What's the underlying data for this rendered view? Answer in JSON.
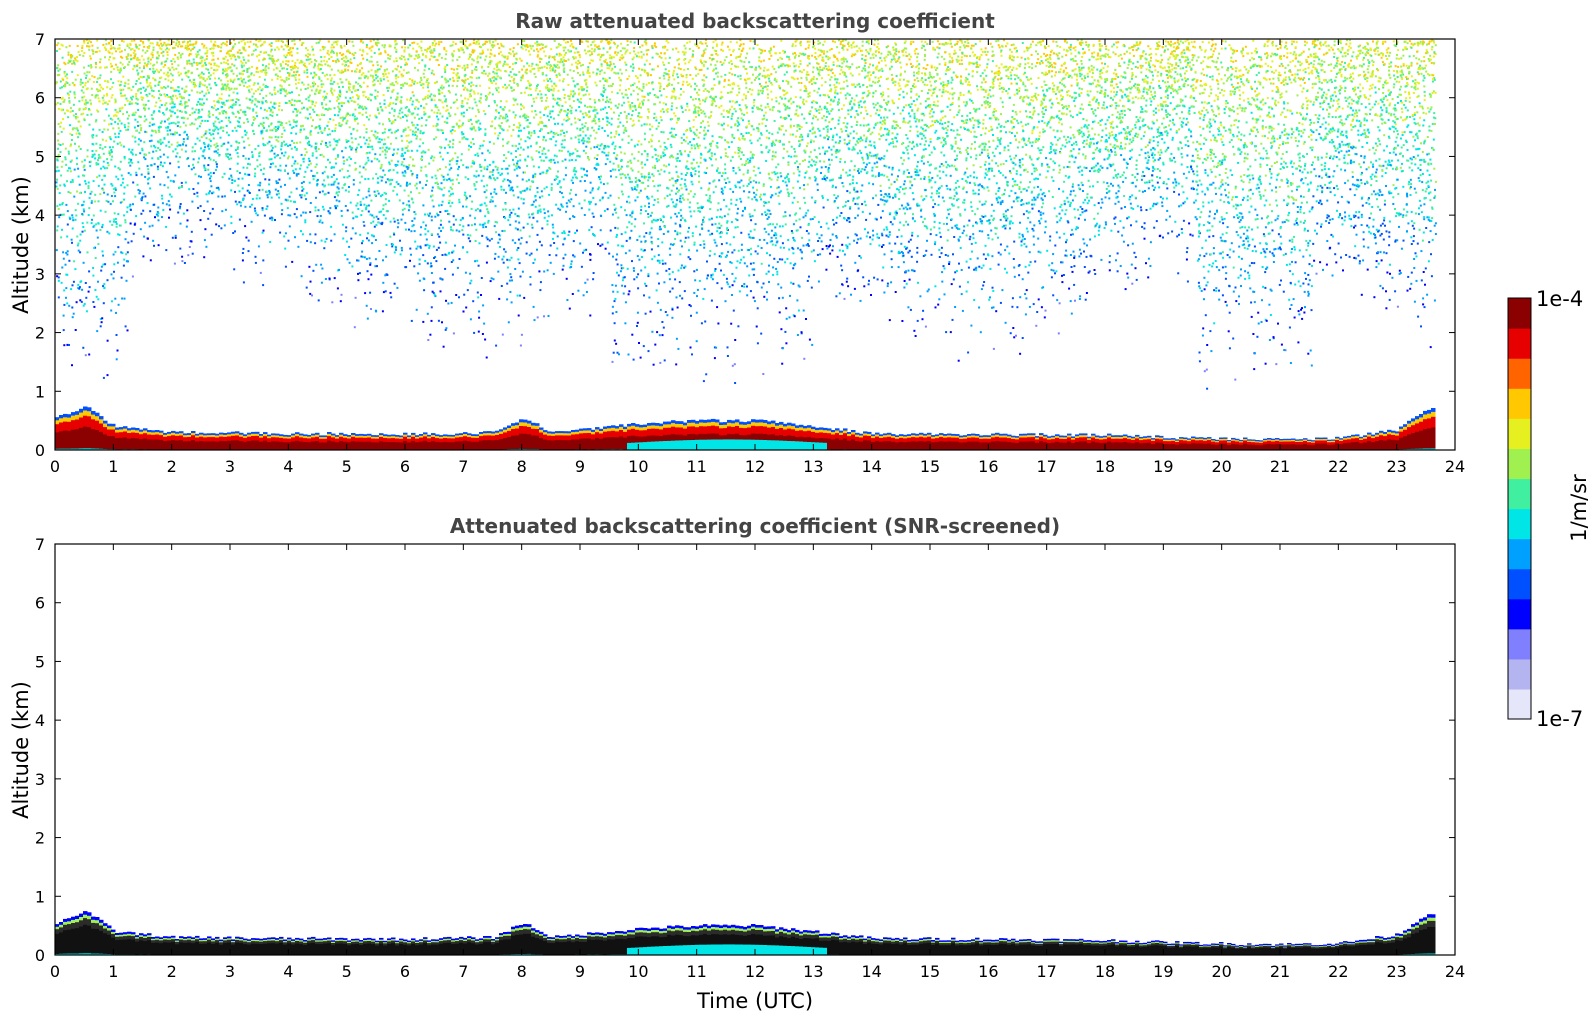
{
  "chart_data": [
    {
      "type": "heatmap",
      "title": "Raw attenuated backscattering coefficient",
      "xlabel": "",
      "ylabel": "Altitude (km)",
      "xlim": [
        0,
        24
      ],
      "ylim": [
        0,
        7
      ],
      "xticks": [
        "0",
        "1",
        "2",
        "3",
        "4",
        "5",
        "6",
        "7",
        "8",
        "9",
        "10",
        "11",
        "12",
        "13",
        "14",
        "15",
        "16",
        "17",
        "18",
        "19",
        "20",
        "21",
        "22",
        "23",
        "24"
      ],
      "yticks": [
        "0",
        "1",
        "2",
        "3",
        "4",
        "5",
        "6",
        "7"
      ],
      "data_end_hour": 23.7,
      "boundary_layer": {
        "time_h": [
          0.0,
          0.5,
          1.0,
          2.0,
          4.0,
          6.0,
          7.5,
          8.0,
          8.5,
          9.0,
          10.0,
          11.0,
          12.0,
          13.0,
          14.0,
          16.0,
          18.0,
          19.5,
          21.0,
          22.0,
          23.0,
          23.5,
          23.7
        ],
        "top_km": [
          0.55,
          0.75,
          0.4,
          0.3,
          0.28,
          0.27,
          0.3,
          0.55,
          0.3,
          0.35,
          0.45,
          0.5,
          0.5,
          0.4,
          0.28,
          0.27,
          0.25,
          0.2,
          0.18,
          0.2,
          0.35,
          0.7,
          0.75
        ]
      },
      "noise_floor_km": [
        {
          "time_h": [
            0,
            1.2
          ],
          "bottom_km": 1.0
        },
        {
          "time_h": [
            9.5,
            13.0
          ],
          "bottom_km": 1.0
        },
        {
          "time_h": [
            19.5,
            21.5
          ],
          "bottom_km": 0.9
        }
      ]
    },
    {
      "type": "heatmap",
      "title": "Attenuated backscattering coefficient (SNR-screened)",
      "xlabel": "Time (UTC)",
      "ylabel": "Altitude (km)",
      "xlim": [
        0,
        24
      ],
      "ylim": [
        0,
        7
      ],
      "xticks": [
        "0",
        "1",
        "2",
        "3",
        "4",
        "5",
        "6",
        "7",
        "8",
        "9",
        "10",
        "11",
        "12",
        "13",
        "14",
        "15",
        "16",
        "17",
        "18",
        "19",
        "20",
        "21",
        "22",
        "23",
        "24"
      ],
      "yticks": [
        "0",
        "1",
        "2",
        "3",
        "4",
        "5",
        "6",
        "7"
      ],
      "data_end_hour": 23.7
    }
  ],
  "colorbar": {
    "label": "1/m/sr",
    "min_label": "1e-7",
    "max_label": "1e-4",
    "scale": "log",
    "colors": [
      "#e6e6fa",
      "#b4b4f0",
      "#8080ff",
      "#0000ff",
      "#0050ff",
      "#00a0ff",
      "#00e6e6",
      "#40f0a0",
      "#a0f050",
      "#e6f020",
      "#ffc800",
      "#ff6400",
      "#e60000",
      "#8b0000"
    ]
  }
}
